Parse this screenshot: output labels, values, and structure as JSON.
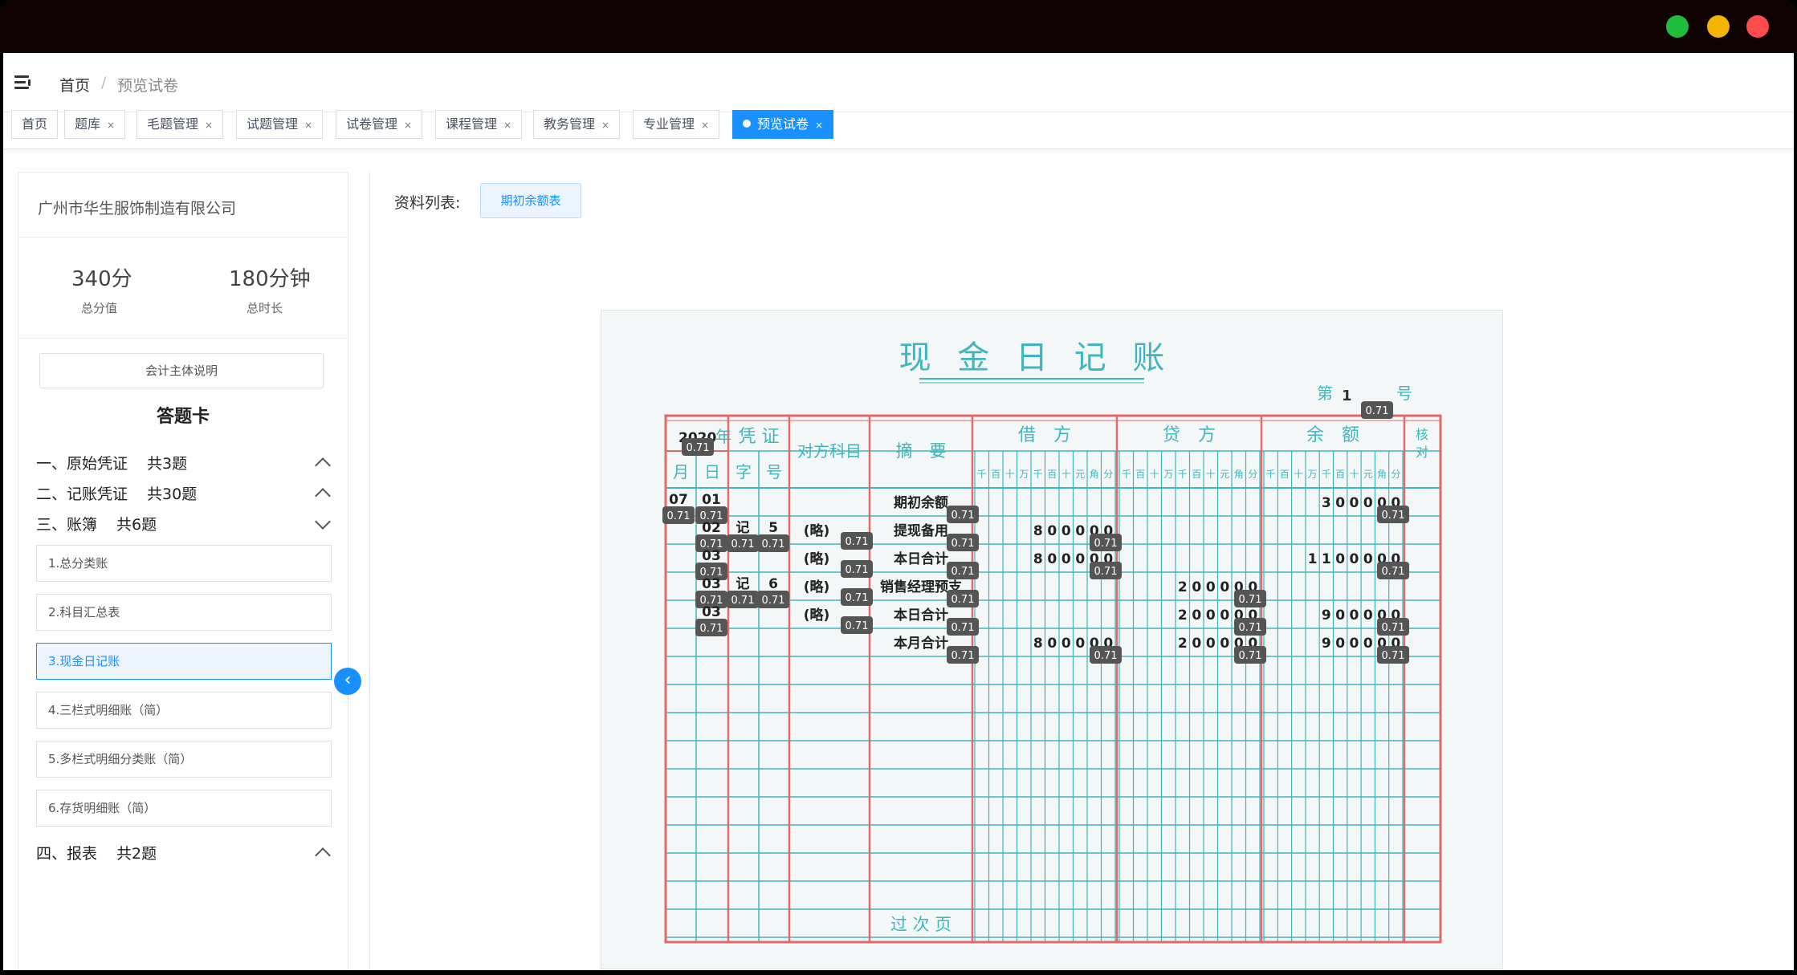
{
  "breadcrumb": {
    "home": "首页",
    "separator": "/",
    "current": "预览试卷"
  },
  "tabs": [
    {
      "label": "首页",
      "closable": false,
      "active": false
    },
    {
      "label": "题库",
      "closable": true,
      "active": false
    },
    {
      "label": "毛题管理",
      "closable": true,
      "active": false
    },
    {
      "label": "试题管理",
      "closable": true,
      "active": false
    },
    {
      "label": "试卷管理",
      "closable": true,
      "active": false
    },
    {
      "label": "课程管理",
      "closable": true,
      "active": false
    },
    {
      "label": "教务管理",
      "closable": true,
      "active": false
    },
    {
      "label": "专业管理",
      "closable": true,
      "active": false
    },
    {
      "label": "预览试卷",
      "closable": true,
      "active": true
    }
  ],
  "tab_close_glyph": "×",
  "left": {
    "company": "广州市华生服饰制造有限公司",
    "score": {
      "value": "340分",
      "label": "总分值"
    },
    "duration": {
      "value": "180分钟",
      "label": "总时长"
    },
    "subject_button": "会计主体说明",
    "card_title": "答题卡",
    "sections": [
      {
        "title": "一、原始凭证",
        "count": "共3题",
        "expanded": false
      },
      {
        "title": "二、记账凭证",
        "count": "共30题",
        "expanded": false
      },
      {
        "title": "三、账簿",
        "count": "共6题",
        "expanded": true
      },
      {
        "title": "四、报表",
        "count": "共2题",
        "expanded": false
      }
    ],
    "book_items": [
      {
        "label": "1.总分类账",
        "active": false
      },
      {
        "label": "2.科目汇总表",
        "active": false
      },
      {
        "label": "3.现金日记账",
        "active": true
      },
      {
        "label": "4.三栏式明细账（简）",
        "active": false
      },
      {
        "label": "5.多栏式明细分类账（简）",
        "active": false
      },
      {
        "label": "6.存货明细账（简）",
        "active": false
      }
    ],
    "collapse_glyph": "‹"
  },
  "right": {
    "materials_label": "资料列表:",
    "materials_button": "期初余额表"
  },
  "ledger": {
    "title": "现 金 日 记 账",
    "page_prefix": "第",
    "page_number": "1",
    "page_suffix": "号",
    "year": "2020",
    "year_suffix": "年",
    "headers": {
      "voucher": "凭 证",
      "counter_account": "对方科目",
      "summary": "摘　要",
      "debit": "借　方",
      "credit": "贷　方",
      "balance": "余　额",
      "check": "核对",
      "month": "月",
      "day": "日",
      "voucher_word": "字",
      "voucher_no": "号",
      "digit_units": [
        "千",
        "百",
        "十",
        "万",
        "千",
        "百",
        "十",
        "元",
        "角",
        "分"
      ]
    },
    "footer": "过 次 页",
    "score_badge": "0.71",
    "accent_red": "#e06a6a",
    "accent_teal": "#3fb6bd",
    "rows": [
      {
        "month": "07",
        "day": "01",
        "word": "",
        "no": "",
        "account": "",
        "summary": "期初余额",
        "debit": "",
        "credit": "",
        "balance": "300000"
      },
      {
        "month": "",
        "day": "02",
        "word": "记",
        "no": "5",
        "account": "(略)",
        "summary": "提现备用",
        "debit": "800000",
        "credit": "",
        "balance": ""
      },
      {
        "month": "",
        "day": "03",
        "word": "",
        "no": "",
        "account": "(略)",
        "summary": "本日合计",
        "debit": "800000",
        "credit": "",
        "balance": "1100000"
      },
      {
        "month": "",
        "day": "03",
        "word": "记",
        "no": "6",
        "account": "(略)",
        "summary": "销售经理预支",
        "debit": "",
        "credit": "200000",
        "balance": ""
      },
      {
        "month": "",
        "day": "03",
        "word": "",
        "no": "",
        "account": "(略)",
        "summary": "本日合计",
        "debit": "",
        "credit": "200000",
        "balance": "900000"
      },
      {
        "month": "",
        "day": "",
        "word": "",
        "no": "",
        "account": "",
        "summary": "本月合计",
        "debit": "800000",
        "credit": "200000",
        "balance": "900000"
      }
    ]
  }
}
